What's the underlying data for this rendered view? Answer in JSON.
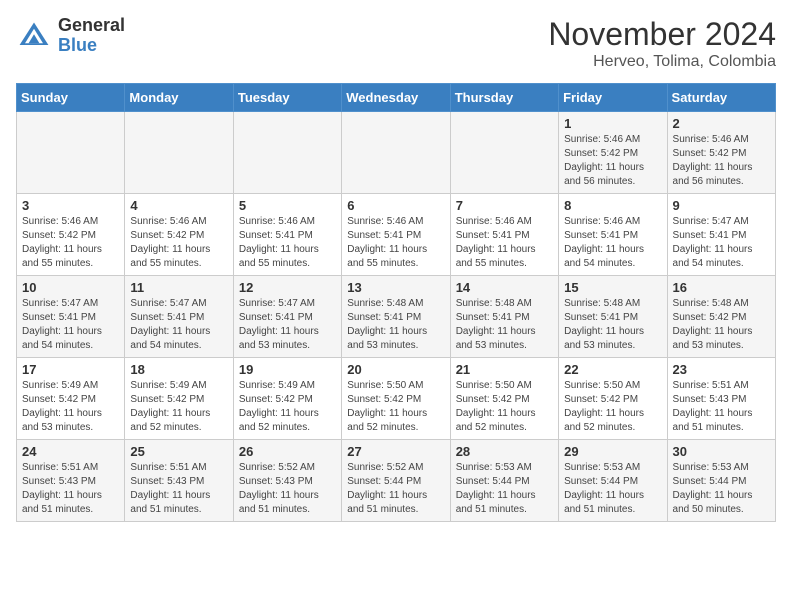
{
  "header": {
    "logo_general": "General",
    "logo_blue": "Blue",
    "month": "November 2024",
    "location": "Herveo, Tolima, Colombia"
  },
  "weekdays": [
    "Sunday",
    "Monday",
    "Tuesday",
    "Wednesday",
    "Thursday",
    "Friday",
    "Saturday"
  ],
  "weeks": [
    [
      {
        "day": "",
        "info": ""
      },
      {
        "day": "",
        "info": ""
      },
      {
        "day": "",
        "info": ""
      },
      {
        "day": "",
        "info": ""
      },
      {
        "day": "",
        "info": ""
      },
      {
        "day": "1",
        "info": "Sunrise: 5:46 AM\nSunset: 5:42 PM\nDaylight: 11 hours\nand 56 minutes."
      },
      {
        "day": "2",
        "info": "Sunrise: 5:46 AM\nSunset: 5:42 PM\nDaylight: 11 hours\nand 56 minutes."
      }
    ],
    [
      {
        "day": "3",
        "info": "Sunrise: 5:46 AM\nSunset: 5:42 PM\nDaylight: 11 hours\nand 55 minutes."
      },
      {
        "day": "4",
        "info": "Sunrise: 5:46 AM\nSunset: 5:42 PM\nDaylight: 11 hours\nand 55 minutes."
      },
      {
        "day": "5",
        "info": "Sunrise: 5:46 AM\nSunset: 5:41 PM\nDaylight: 11 hours\nand 55 minutes."
      },
      {
        "day": "6",
        "info": "Sunrise: 5:46 AM\nSunset: 5:41 PM\nDaylight: 11 hours\nand 55 minutes."
      },
      {
        "day": "7",
        "info": "Sunrise: 5:46 AM\nSunset: 5:41 PM\nDaylight: 11 hours\nand 55 minutes."
      },
      {
        "day": "8",
        "info": "Sunrise: 5:46 AM\nSunset: 5:41 PM\nDaylight: 11 hours\nand 54 minutes."
      },
      {
        "day": "9",
        "info": "Sunrise: 5:47 AM\nSunset: 5:41 PM\nDaylight: 11 hours\nand 54 minutes."
      }
    ],
    [
      {
        "day": "10",
        "info": "Sunrise: 5:47 AM\nSunset: 5:41 PM\nDaylight: 11 hours\nand 54 minutes."
      },
      {
        "day": "11",
        "info": "Sunrise: 5:47 AM\nSunset: 5:41 PM\nDaylight: 11 hours\nand 54 minutes."
      },
      {
        "day": "12",
        "info": "Sunrise: 5:47 AM\nSunset: 5:41 PM\nDaylight: 11 hours\nand 53 minutes."
      },
      {
        "day": "13",
        "info": "Sunrise: 5:48 AM\nSunset: 5:41 PM\nDaylight: 11 hours\nand 53 minutes."
      },
      {
        "day": "14",
        "info": "Sunrise: 5:48 AM\nSunset: 5:41 PM\nDaylight: 11 hours\nand 53 minutes."
      },
      {
        "day": "15",
        "info": "Sunrise: 5:48 AM\nSunset: 5:41 PM\nDaylight: 11 hours\nand 53 minutes."
      },
      {
        "day": "16",
        "info": "Sunrise: 5:48 AM\nSunset: 5:42 PM\nDaylight: 11 hours\nand 53 minutes."
      }
    ],
    [
      {
        "day": "17",
        "info": "Sunrise: 5:49 AM\nSunset: 5:42 PM\nDaylight: 11 hours\nand 53 minutes."
      },
      {
        "day": "18",
        "info": "Sunrise: 5:49 AM\nSunset: 5:42 PM\nDaylight: 11 hours\nand 52 minutes."
      },
      {
        "day": "19",
        "info": "Sunrise: 5:49 AM\nSunset: 5:42 PM\nDaylight: 11 hours\nand 52 minutes."
      },
      {
        "day": "20",
        "info": "Sunrise: 5:50 AM\nSunset: 5:42 PM\nDaylight: 11 hours\nand 52 minutes."
      },
      {
        "day": "21",
        "info": "Sunrise: 5:50 AM\nSunset: 5:42 PM\nDaylight: 11 hours\nand 52 minutes."
      },
      {
        "day": "22",
        "info": "Sunrise: 5:50 AM\nSunset: 5:42 PM\nDaylight: 11 hours\nand 52 minutes."
      },
      {
        "day": "23",
        "info": "Sunrise: 5:51 AM\nSunset: 5:43 PM\nDaylight: 11 hours\nand 51 minutes."
      }
    ],
    [
      {
        "day": "24",
        "info": "Sunrise: 5:51 AM\nSunset: 5:43 PM\nDaylight: 11 hours\nand 51 minutes."
      },
      {
        "day": "25",
        "info": "Sunrise: 5:51 AM\nSunset: 5:43 PM\nDaylight: 11 hours\nand 51 minutes."
      },
      {
        "day": "26",
        "info": "Sunrise: 5:52 AM\nSunset: 5:43 PM\nDaylight: 11 hours\nand 51 minutes."
      },
      {
        "day": "27",
        "info": "Sunrise: 5:52 AM\nSunset: 5:44 PM\nDaylight: 11 hours\nand 51 minutes."
      },
      {
        "day": "28",
        "info": "Sunrise: 5:53 AM\nSunset: 5:44 PM\nDaylight: 11 hours\nand 51 minutes."
      },
      {
        "day": "29",
        "info": "Sunrise: 5:53 AM\nSunset: 5:44 PM\nDaylight: 11 hours\nand 51 minutes."
      },
      {
        "day": "30",
        "info": "Sunrise: 5:53 AM\nSunset: 5:44 PM\nDaylight: 11 hours\nand 50 minutes."
      }
    ]
  ]
}
